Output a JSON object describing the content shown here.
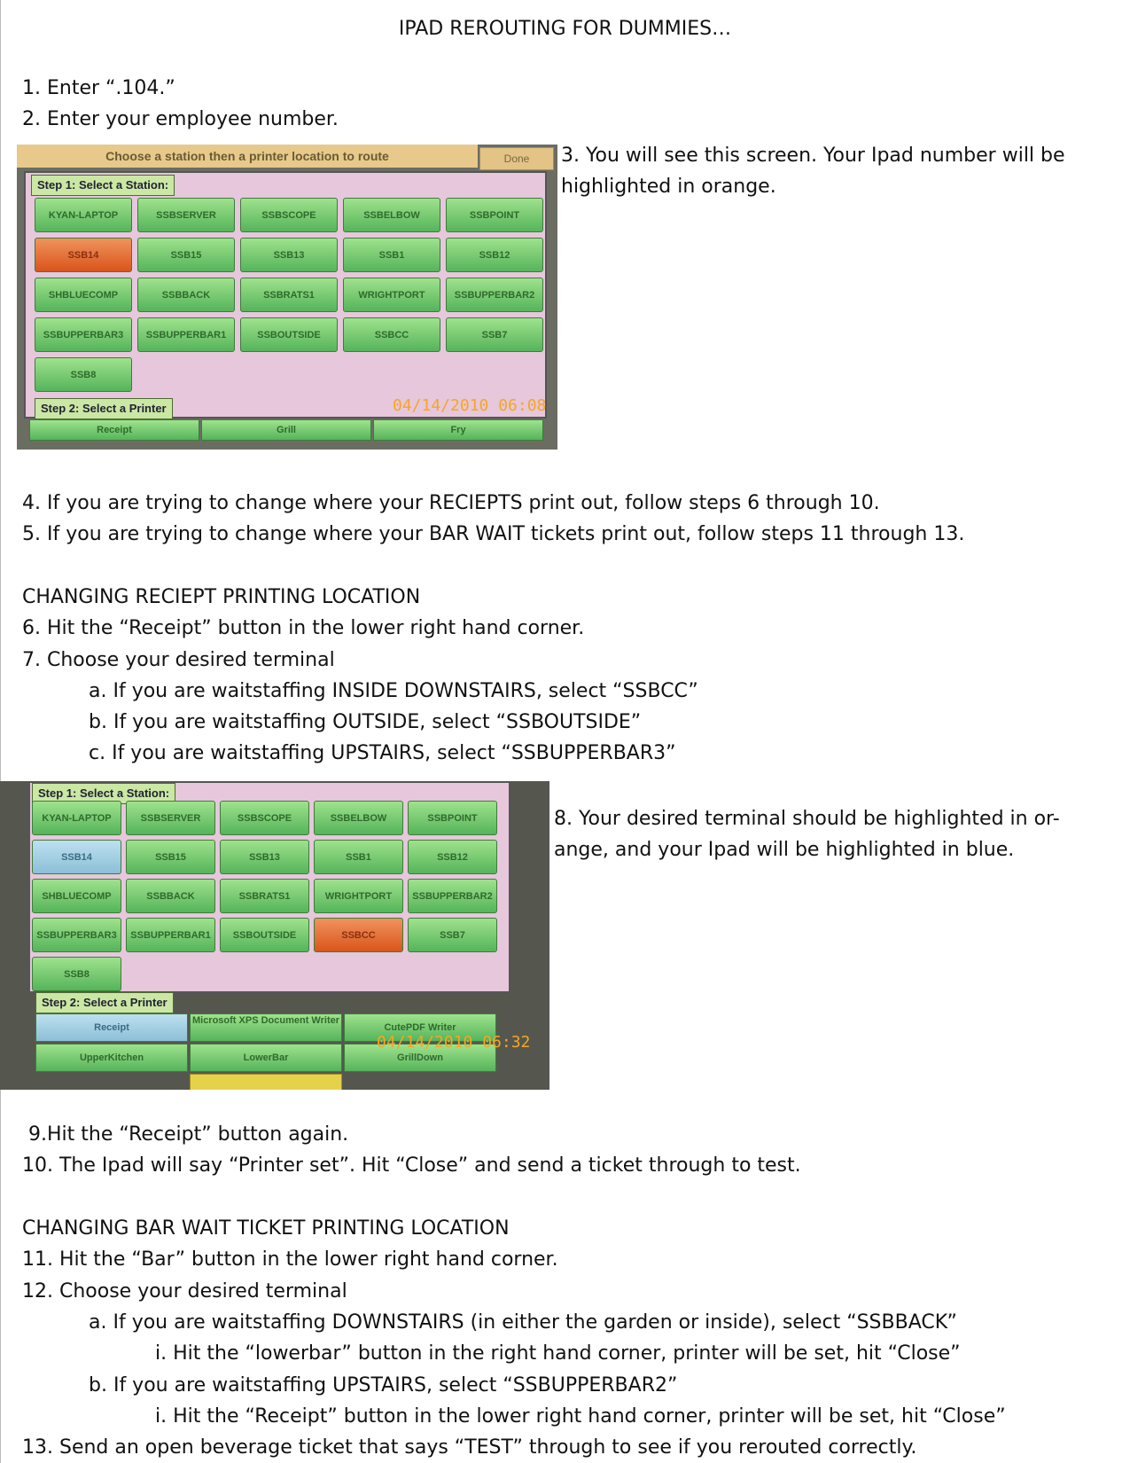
{
  "title": "IPAD REROUTING FOR DUMMIES…",
  "steps": {
    "s1": "1.  Enter “.104.”",
    "s2": "2.  Enter your employee number.",
    "s3a": "3.  You will see this screen.  Your Ipad number will be",
    "s3b": "highlighted in orange.",
    "s4": "4. If you are trying to change where your RECIEPTS print out, follow steps 6 through 10.",
    "s5": "5. If you are trying to change where your BAR WAIT tickets print out, follow steps 11 through 13.",
    "h1": "CHANGING RECIEPT PRINTING LOCATION",
    "s6": "6. Hit the “Receipt” button in the lower right hand corner.",
    "s7": "7. Choose your desired terminal",
    "s7a": "a. If you are waitstaffing INSIDE DOWNSTAIRS, select “SSBCC”",
    "s7b": "b. If you are waitstaffing OUTSIDE, select “SSBOUTSIDE”",
    "s7c": "c. If you are waitstaffing UPSTAIRS, select “SSBUPPERBAR3”",
    "s8a": "8. Your desired terminal should be highlighted in or-",
    "s8b": "ange, and your Ipad will be highlighted in blue.",
    "s9": " 9.Hit the “Receipt” button again.",
    "s10": "10. The Ipad will say “Printer set”. Hit “Close” and send a ticket through to test.",
    "h2": "CHANGING BAR WAIT TICKET PRINTING LOCATION",
    "s11": "11. Hit the “Bar” button in the lower right hand corner.",
    "s12": "12. Choose your desired terminal",
    "s12a": "a. If you are waitstaffing DOWNSTAIRS (in either the garden or inside), select “SSBBACK”",
    "s12ai": "i. Hit the “lowerbar” button in the right hand corner, printer will be set, hit “Close”",
    "s12b": "b. If you are waitstaffing UPSTAIRS, select “SSBUPPERBAR2”",
    "s12bi": "i. Hit the “Receipt” button in the lower right hand corner, printer will be set, hit “Close”",
    "s13": "13. Send an open beverage ticket that says “TEST” through to see if you rerouted correctly."
  },
  "screen1": {
    "banner": "Choose a station then a printer location to route",
    "done": "Done",
    "step1": "Step 1: Select a Station:",
    "step2": "Step 2: Select a Printer",
    "timestamp": "04/14/2010  06:08",
    "stations": [
      "KYAN-LAPTOP",
      "SSBSERVER",
      "SSBSCOPE",
      "SSBELBOW",
      "SSBPOINT",
      "SSB14",
      "SSB15",
      "SSB13",
      "SSB1",
      "SSB12",
      "SHBLUECOMP",
      "SSBBACK",
      "SSBRATS1",
      "WRIGHTPORT",
      "SSBUPPERBAR2",
      "SSBUPPERBAR3",
      "SSBUPPERBAR1",
      "SSBOUTSIDE",
      "SSBCC",
      "SSB7",
      "SSB8"
    ],
    "printers": [
      "Receipt",
      "Grill",
      "Fry"
    ]
  },
  "screen2": {
    "step1": "Step 1: Select a Station:",
    "step2": "Step 2: Select a Printer",
    "timestamp": "04/14/2010  06:32",
    "stations": [
      "KYAN-LAPTOP",
      "SSBSERVER",
      "SSBSCOPE",
      "SSBELBOW",
      "SSBPOINT",
      "SSB14",
      "SSB15",
      "SSB13",
      "SSB1",
      "SSB12",
      "SHBLUECOMP",
      "SSBBACK",
      "SSBRATS1",
      "WRIGHTPORT",
      "SSBUPPERBAR2",
      "SSBUPPERBAR3",
      "SSBUPPERBAR1",
      "SSBOUTSIDE",
      "SSBCC",
      "SSB7",
      "SSB8"
    ],
    "printers": [
      "Receipt",
      "Microsoft XPS Document Writer",
      "CutePDF Writer",
      "UpperKitchen",
      "LowerBar",
      "GrillDown"
    ]
  }
}
